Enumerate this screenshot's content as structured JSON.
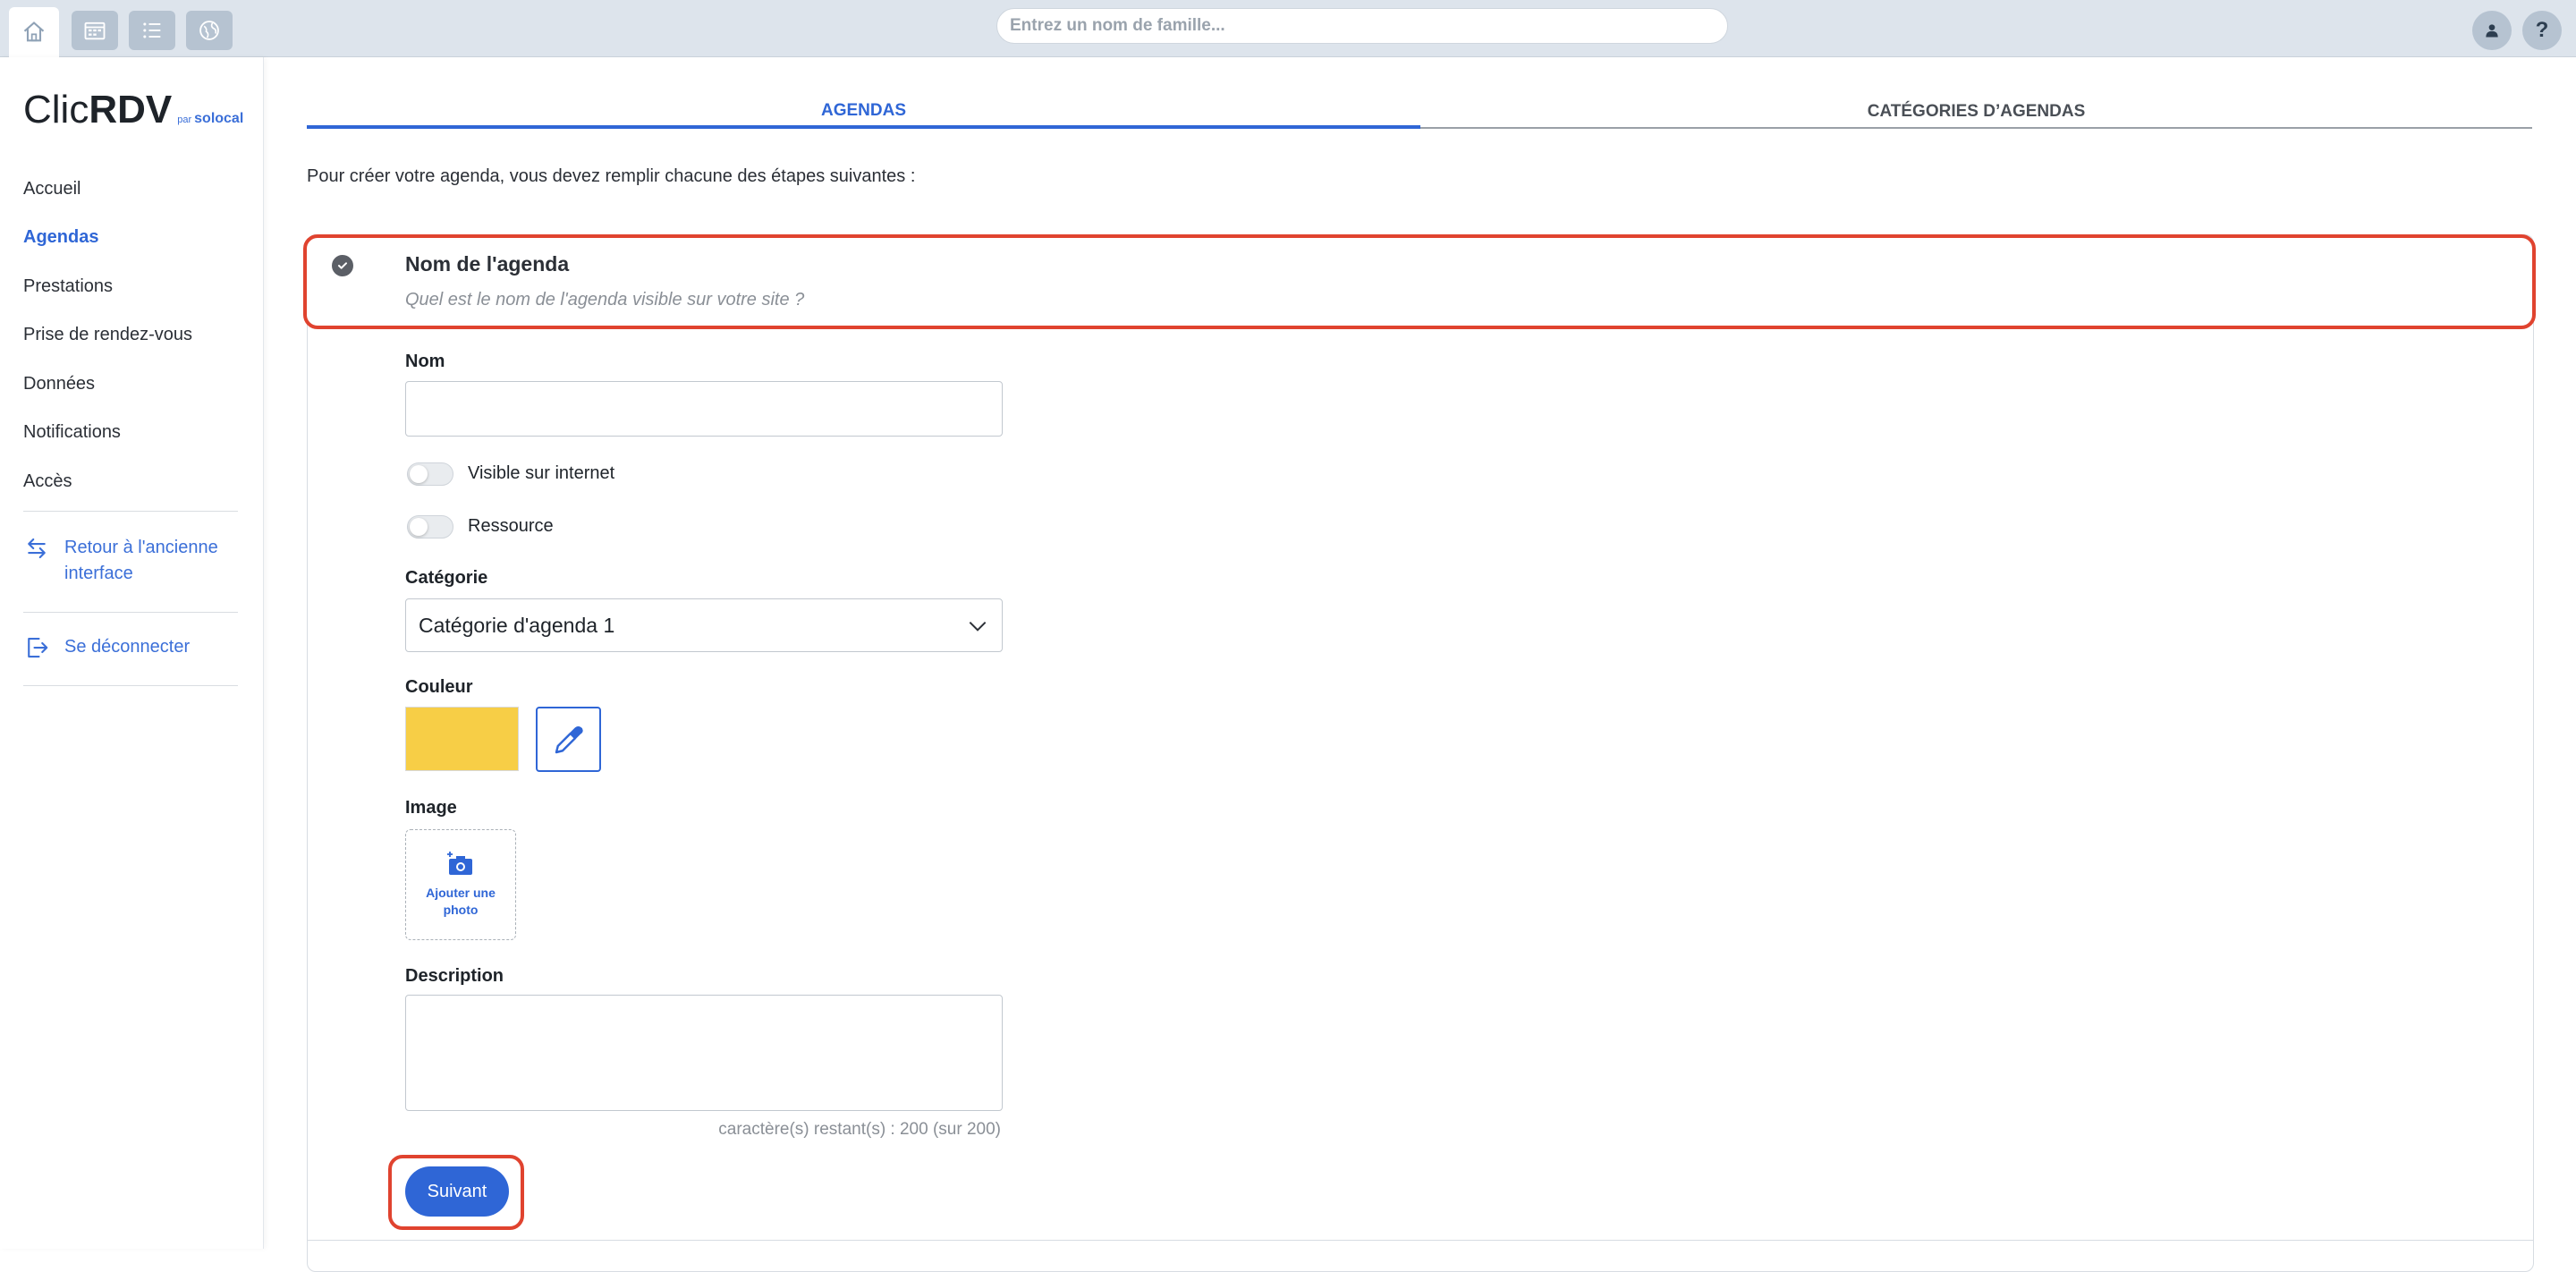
{
  "topbar": {
    "search_placeholder": "Entrez un nom de famille...",
    "help_label": "?"
  },
  "sidebar": {
    "logo": {
      "clic": "Clic",
      "rdv": "RDV",
      "par": "par",
      "solocal": "solocal"
    },
    "items": [
      {
        "label": "Accueil",
        "active": false
      },
      {
        "label": "Agendas",
        "active": true
      },
      {
        "label": "Prestations",
        "active": false
      },
      {
        "label": "Prise de rendez-vous",
        "active": false
      },
      {
        "label": "Données",
        "active": false
      },
      {
        "label": "Notifications",
        "active": false
      },
      {
        "label": "Accès",
        "active": false
      }
    ],
    "back_link": "Retour à l'ancienne interface",
    "logout": "Se déconnecter"
  },
  "tabs": [
    {
      "label": "AGENDAS",
      "active": true
    },
    {
      "label": "CATÉGORIES D’AGENDAS",
      "active": false
    }
  ],
  "intro": "Pour créer votre agenda, vous devez remplir chacune des étapes suivantes :",
  "step": {
    "title": "Nom de l'agenda",
    "subtitle": "Quel est le nom de l'agenda visible sur votre site ?"
  },
  "form": {
    "nom_label": "Nom",
    "nom_value": "",
    "visible_label": "Visible sur internet",
    "visible_on": false,
    "ressource_label": "Ressource",
    "ressource_on": false,
    "categorie_label": "Catégorie",
    "categorie_value": "Catégorie d'agenda 1",
    "couleur_label": "Couleur",
    "couleur_value": "#f7ce46",
    "image_label": "Image",
    "add_photo": "Ajouter une photo",
    "description_label": "Description",
    "counter": "caractère(s) restant(s) : 200 (sur 200)",
    "next_label": "Suivant"
  },
  "colors": {
    "accent": "#2f66d6",
    "highlight": "#e0432f"
  }
}
